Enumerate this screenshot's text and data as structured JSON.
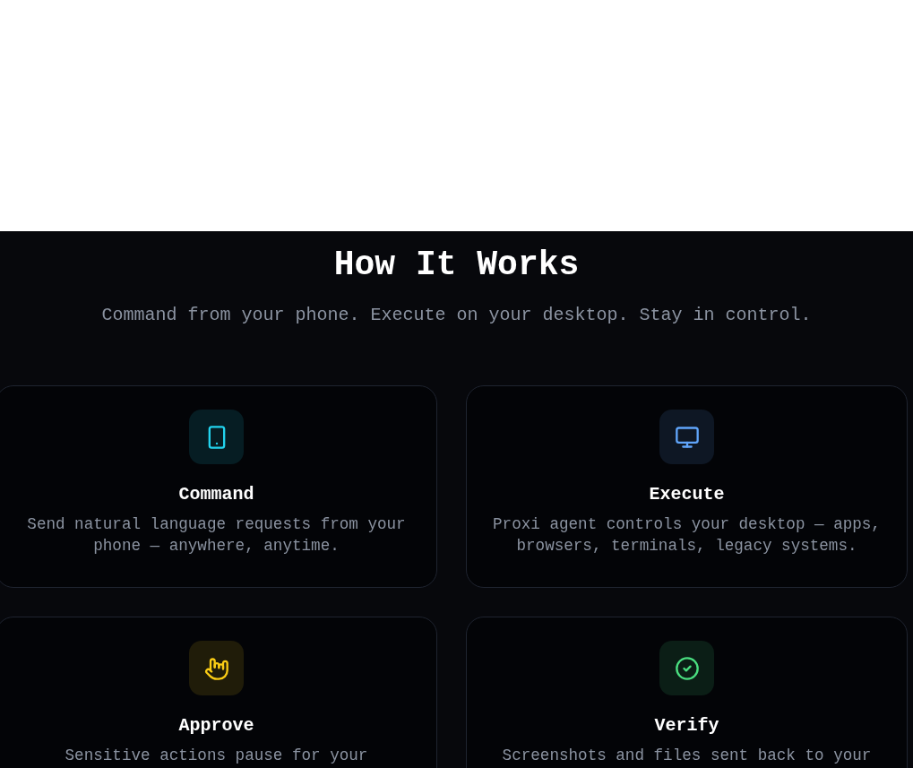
{
  "section": {
    "title": "How It Works",
    "subtitle": "Command from your phone. Execute on your desktop. Stay in control."
  },
  "steps": [
    {
      "kind": "phone",
      "color": "#22d3ee",
      "title": "Command",
      "description": "Send natural language requests from your phone — anywhere, anytime."
    },
    {
      "kind": "monitor",
      "color": "#60a5fa",
      "title": "Execute",
      "description": "Proxi agent controls your desktop — apps, browsers, terminals, legacy systems."
    },
    {
      "kind": "hand",
      "color": "#facc15",
      "title": "Approve",
      "description": "Sensitive actions pause for your"
    },
    {
      "kind": "check",
      "color": "#4ade80",
      "title": "Verify",
      "description": "Screenshots and files sent back to your"
    }
  ]
}
